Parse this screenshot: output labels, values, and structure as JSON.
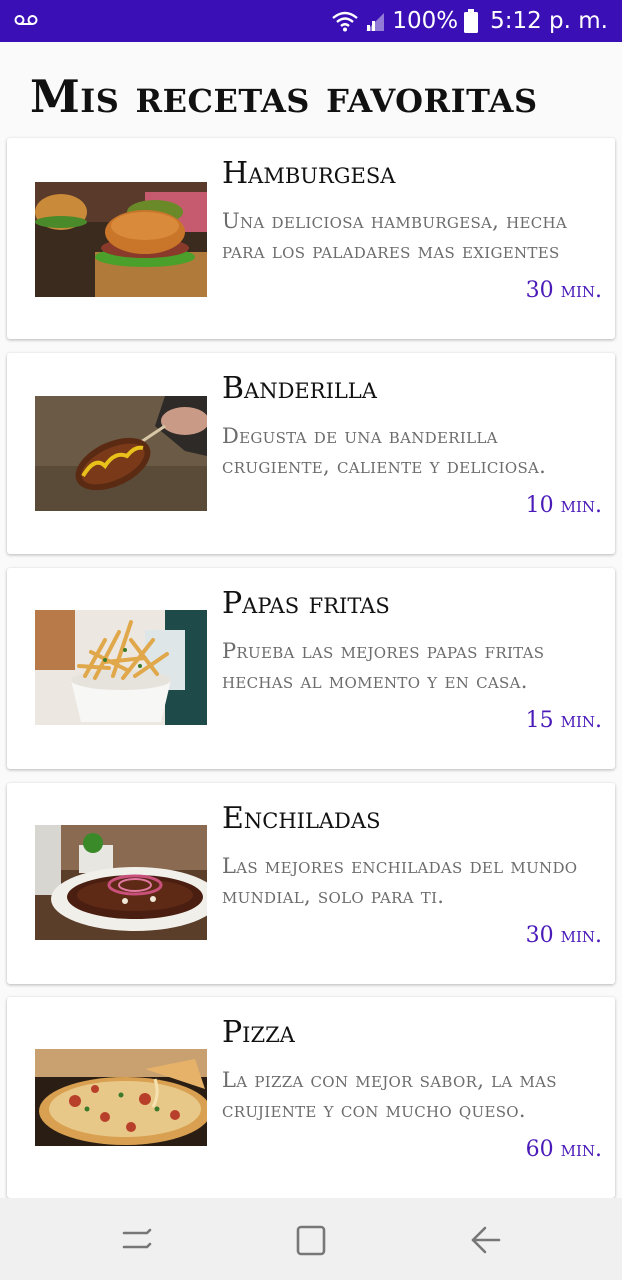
{
  "status_bar": {
    "battery": "100%",
    "time": "5:12 p. m.",
    "left_icon": "voicemail-icon",
    "right_icons": [
      "wifi-icon",
      "signal-icon",
      "battery-icon"
    ]
  },
  "header": {
    "title": "Mis recetas favoritas"
  },
  "recipes": [
    {
      "title": "Hamburgesa",
      "description": "Una deliciosa hamburgesa, hecha para los paladares mas exigentes",
      "time": "30 min.",
      "image": "hamburger-photo"
    },
    {
      "title": "Banderilla",
      "description": "Degusta de una banderilla crugiente, caliente y deliciosa.",
      "time": "10 min.",
      "image": "corndog-photo"
    },
    {
      "title": "Papas fritas",
      "description": "Prueba las mejores papas fritas hechas al momento y en casa.",
      "time": "15 min.",
      "image": "fries-photo"
    },
    {
      "title": "Enchiladas",
      "description": "Las mejores enchiladas del mundo mundial, solo para ti.",
      "time": "30 min.",
      "image": "enchiladas-photo"
    },
    {
      "title": "Pizza",
      "description": "La pizza con mejor sabor, la mas crujiente y con mucho queso.",
      "time": "60 min.",
      "image": "pizza-photo"
    }
  ],
  "nav_bar": {
    "buttons": [
      "recent-apps-icon",
      "home-icon",
      "back-icon"
    ]
  },
  "colors": {
    "status_bar": "#3a0fb5",
    "accent": "#4a1ab8",
    "background": "#fafafa"
  }
}
